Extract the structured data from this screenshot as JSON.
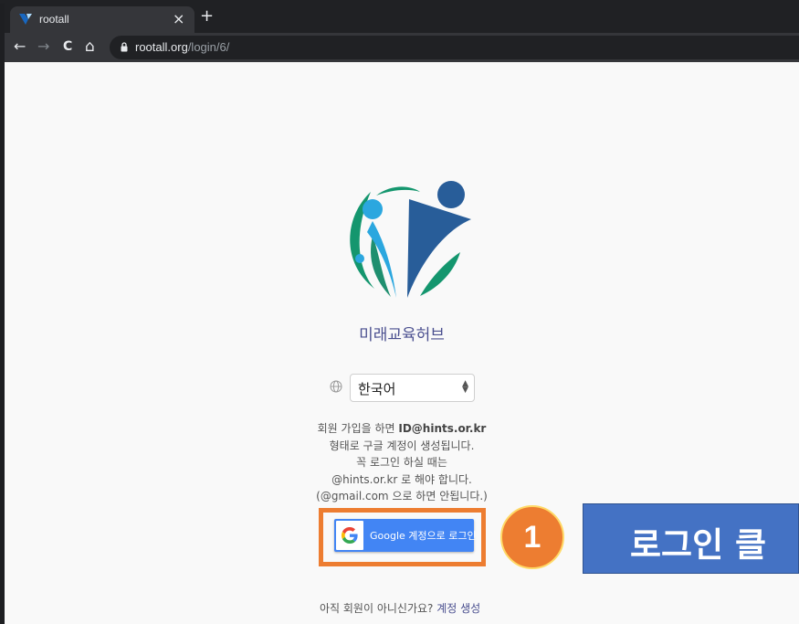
{
  "browser": {
    "tab_title": "rootall",
    "tab_close": "×",
    "new_tab": "+",
    "url_host": "rootall.org",
    "url_path": "/login/6/",
    "nav": {
      "back": "←",
      "forward": "→",
      "reload": "C",
      "home": "⌂"
    }
  },
  "page": {
    "org_name": "미래교육허브",
    "language": {
      "selected": "한국어"
    },
    "info": {
      "line1_prefix": "회원 가입을 하면 ",
      "line1_bold": "ID@hints.or.kr",
      "line2": "형태로 구글 계정이 생성됩니다.",
      "line3": "꼭 로그인 하실 때는",
      "line4": "@hints.or.kr 로 해야 합니다.",
      "line5": "(@gmail.com 으로 하면 안됩니다.)"
    },
    "google_button_label": "Google 계정으로 로그인",
    "signup_prompt": "아직 회원이 아니신가요?",
    "signup_link": "계정 생성"
  },
  "annotation": {
    "step_number": "1",
    "callout_text": "로그인 클",
    "highlight_color": "#ed7d31",
    "callout_color": "#4472c4"
  }
}
